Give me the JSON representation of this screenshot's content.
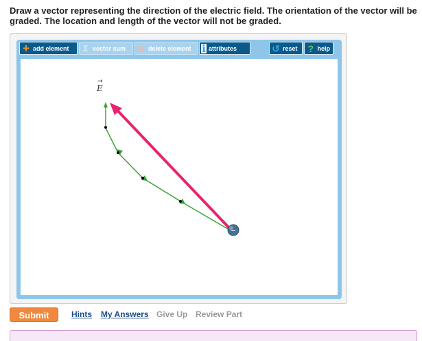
{
  "question": {
    "text": "Draw a vector representing the direction of the electric field. The orientation of the vector will be graded. The location and length of the vector will not be graded."
  },
  "toolbar": {
    "add_element": "add element",
    "vector_sum": "vector sum",
    "delete_element": "delete element",
    "attributes": "attributes",
    "reset": "reset",
    "help": "help"
  },
  "canvas": {
    "field_label": "E",
    "field_label_arrow": "→",
    "charge_sign": "−"
  },
  "actions": {
    "submit": "Submit",
    "hints": "Hints",
    "my_answers": "My Answers",
    "give_up": "Give Up",
    "review_part": "Review Part"
  },
  "colors": {
    "toolbar_bg": "#0b5a8c",
    "frame_bg": "#8ec6ea",
    "field_line": "#3aa33a",
    "user_vector": "#e8236f",
    "charge": "#4a6f95",
    "submit_bg": "#f0883e",
    "feedback_bg": "#f6e8f7"
  },
  "icons": {
    "add_element": "plus-icon",
    "vector_sum": "sigma-icon",
    "delete_element": "x-icon",
    "attributes": "info-icon",
    "reset": "reset-icon",
    "help": "help-icon"
  }
}
